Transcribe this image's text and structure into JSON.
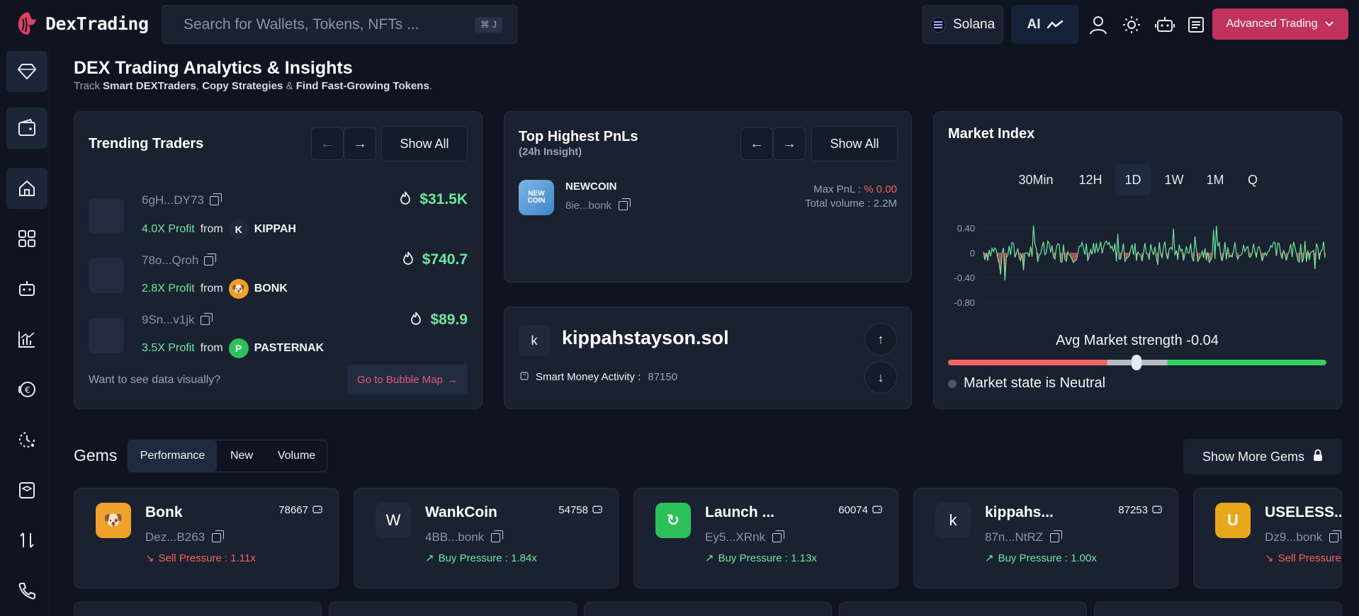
{
  "brand": {
    "name": "DexTrading"
  },
  "search": {
    "placeholder": "Search for Wallets, Tokens, NFTs ...",
    "shortcut": "⌘ J"
  },
  "header": {
    "chain": "Solana",
    "ai_label": "AI",
    "advanced_label": "Advanced Trading"
  },
  "page": {
    "title": "DEX Trading Analytics & Insights",
    "sub_prefix": "Track ",
    "sub_b1": "Smart DEXTraders",
    "sub_sep1": ", ",
    "sub_b2": "Copy Strategies",
    "sub_sep2": " & ",
    "sub_b3": "Find Fast-Growing Tokens",
    "sub_end": "."
  },
  "trending": {
    "title": "Trending Traders",
    "show_all": "Show All",
    "from_label": "from",
    "traders": [
      {
        "address": "6gH...DY73",
        "profit": "4.0X Profit",
        "token": "KIPPAH",
        "token_initial": "K",
        "value": "$31.5K"
      },
      {
        "address": "78o...Qroh",
        "profit": "2.8X Profit",
        "token": "BONK",
        "token_initial": "🐶",
        "value": "$740.7"
      },
      {
        "address": "9Sn...v1jk",
        "profit": "3.5X Profit",
        "token": "PASTERNAK",
        "token_initial": "P",
        "value": "$89.9"
      }
    ],
    "prompt": "Want to see data visually?",
    "bubble_link": "Go to Bubble Map"
  },
  "pnl": {
    "title": "Top Highest PnLs",
    "subtitle": "(24h Insight)",
    "show_all": "Show All",
    "token_name": "NEWCOIN",
    "token_logo_text": "NEW COIN",
    "token_addr": "8ie...bonk",
    "max_pnl_label": "Max PnL :",
    "max_pnl_value": "% 0.00",
    "total_volume": "Total volume : 2.2M"
  },
  "wallet": {
    "initial": "k",
    "name": "kippahstayson.sol",
    "activity_label": "Smart Money Activity :",
    "activity_value": "87150"
  },
  "market": {
    "title": "Market Index",
    "timeframes": [
      "30Min",
      "12H",
      "1D",
      "1W",
      "1M",
      "Q"
    ],
    "active_timeframe": "1D",
    "y_ticks": [
      "0.40",
      "0",
      "-0.40",
      "-0.80"
    ],
    "strength_label": "Avg Market strength -0.04",
    "strength_value": -0.04,
    "state_label": "Market state is Neutral",
    "colors": {
      "positive": "#6ee7a0",
      "negative": "#f36363"
    }
  },
  "gems": {
    "title": "Gems",
    "tabs": [
      "Performance",
      "New",
      "Volume"
    ],
    "more_label": "Show More Gems",
    "cards": [
      {
        "name": "Bonk",
        "count": "78667",
        "address": "Dez...B263",
        "pressure": "Sell Pressure : 1.11x",
        "logo": "🐶"
      },
      {
        "name": "WankCoin",
        "count": "54758",
        "address": "4BB...bonk",
        "pressure": "Buy Pressure : 1.84x",
        "logo": "W"
      },
      {
        "name": "Launch ...",
        "count": "60074",
        "address": "Ey5...XRnk",
        "pressure": "Buy Pressure : 1.13x",
        "logo": "↻"
      },
      {
        "name": "kippahs...",
        "count": "87253",
        "address": "87n...NtRZ",
        "pressure": "Buy Pressure : 1.00x",
        "logo": "k"
      },
      {
        "name": "USELESS...",
        "count": "",
        "address": "Dz9...bonk",
        "pressure": "Sell Pressure",
        "logo": "U"
      }
    ]
  }
}
